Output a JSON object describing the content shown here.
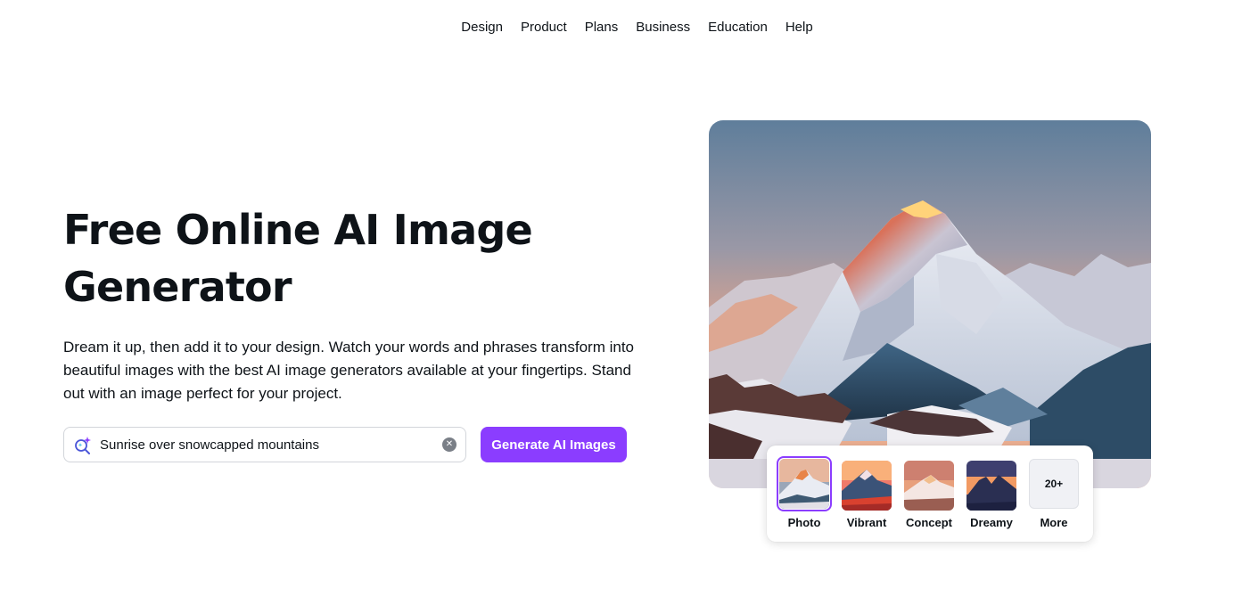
{
  "nav": {
    "items": [
      "Design",
      "Product",
      "Plans",
      "Business",
      "Education",
      "Help"
    ]
  },
  "hero": {
    "title_line1": "Free Online AI Image",
    "title_line2": "Generator",
    "description": "Dream it up, then add it to your design. Watch your words and phrases transform into beautiful images with the best AI image generators available at your fingertips. Stand out with an image perfect for your project."
  },
  "search": {
    "value": "Sunrise over snowcapped mountains",
    "icon": "sparkle-search-icon",
    "clear_icon": "clear-icon"
  },
  "generate_button": {
    "label": "Generate AI Images"
  },
  "styles": {
    "selected": "Photo",
    "options": [
      {
        "label": "Photo"
      },
      {
        "label": "Vibrant"
      },
      {
        "label": "Concept"
      },
      {
        "label": "Dreamy"
      },
      {
        "label": "More",
        "badge": "20+"
      }
    ]
  },
  "colors": {
    "accent": "#8b3dff",
    "text": "#0e1318",
    "border": "#d2d5da"
  }
}
